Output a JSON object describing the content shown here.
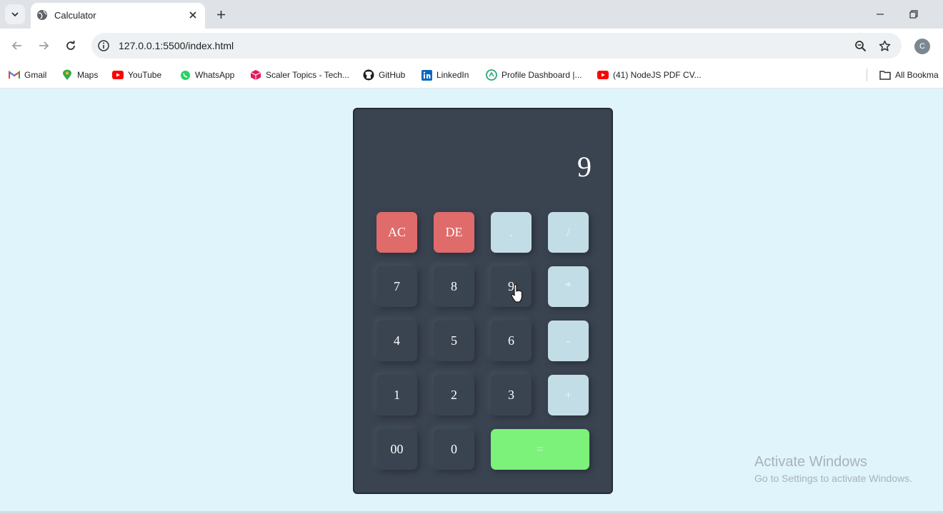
{
  "browser": {
    "tab_title": "Calculator",
    "url": "127.0.0.1:5500/index.html",
    "profile_initial": "C",
    "bookmarks": [
      {
        "label": "Gmail",
        "icon": "gmail-icon"
      },
      {
        "label": "Maps",
        "icon": "maps-icon"
      },
      {
        "label": "YouTube",
        "icon": "youtube-icon"
      },
      {
        "label": "WhatsApp",
        "icon": "whatsapp-icon"
      },
      {
        "label": "Scaler Topics - Tech...",
        "icon": "scaler-icon"
      },
      {
        "label": "GitHub",
        "icon": "github-icon"
      },
      {
        "label": "LinkedIn",
        "icon": "linkedin-icon"
      },
      {
        "label": "Profile Dashboard |...",
        "icon": "dashboard-icon"
      },
      {
        "label": "(41) NodeJS PDF CV...",
        "icon": "youtube-icon"
      }
    ],
    "all_bookmarks": "All Bookma"
  },
  "calculator": {
    "display": "9",
    "keys": {
      "ac": "AC",
      "de": "DE",
      "dot": ".",
      "divide": "/",
      "seven": "7",
      "eight": "8",
      "nine": "9",
      "multiply": "*",
      "four": "4",
      "five": "5",
      "six": "6",
      "minus": "-",
      "one": "1",
      "two": "2",
      "three": "3",
      "plus": "+",
      "double_zero": "00",
      "zero": "0",
      "equals": "="
    }
  },
  "colors": {
    "page_bg": "#dff4fb",
    "calculator_bg": "#3a4350",
    "clear_keys": "#e06b6b",
    "operator_keys": "#c3dde6",
    "equals_key": "#7cf27a"
  },
  "watermark": {
    "title": "Activate Windows",
    "subtitle": "Go to Settings to activate Windows."
  }
}
